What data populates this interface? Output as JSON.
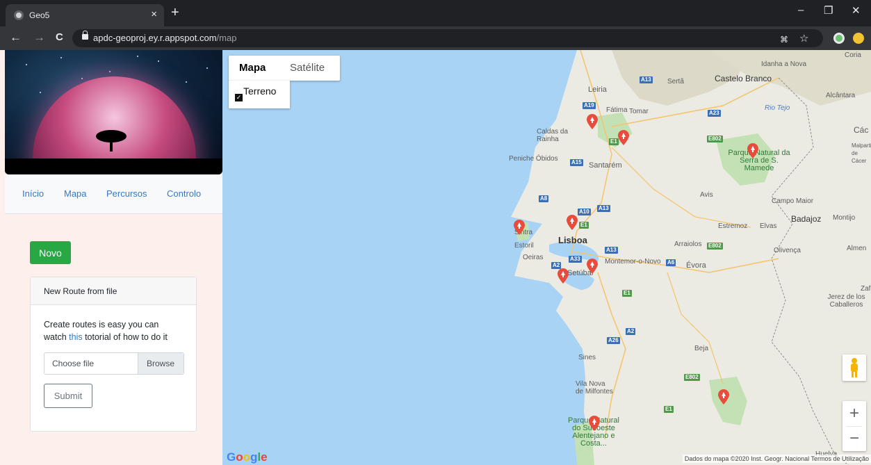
{
  "browser": {
    "tab_title": "Geo5",
    "tab_close": "×",
    "new_tab": "+",
    "minimize": "–",
    "restore": "❐",
    "close": "✕",
    "back": "←",
    "forward": "→",
    "reload": "C",
    "url_host": "apdc-geoproj.ey.r.appspot.com",
    "url_path": "/map",
    "translate_icon": "⌘",
    "bookmark_star": "☆"
  },
  "nav": {
    "items": [
      "Início",
      "Mapa",
      "Percursos",
      "Controlo"
    ]
  },
  "novo_button": "Novo",
  "card": {
    "header": "New Route from file",
    "text_before": "Create routes is easy you can watch ",
    "link": "this",
    "text_after": " totorial of how to do it",
    "file_placeholder": "Choose file",
    "browse": "Browse",
    "submit": "Submit"
  },
  "map": {
    "type_map": "Mapa",
    "type_satellite": "Satélite",
    "terrain": "Terreno",
    "terrain_checked": true,
    "zoom_in": "+",
    "zoom_out": "−",
    "google_logo": "Google",
    "attribution": "Dados do mapa ©2020 Inst. Geogr. Nacional   Termos de Utilização",
    "labels": {
      "coria": "Coria",
      "idanha": "Idanha a Nova",
      "castelo_branco": "Castelo Branco",
      "serta": "Sertã",
      "alcantara": "Alcântara",
      "leiria": "Leiria",
      "fatima": "Fátima",
      "tomar": "Tomar",
      "rio_tejo": "Rio Tejo",
      "caldas": "Caldas da Rainha",
      "caceres_abbr": "Các",
      "malpartida": "Malparti de Cácer",
      "peniche": "Peniche Óbidos",
      "santarem": "Santarém",
      "parque_serra": "Parque Natural da Serra de S. Mamede",
      "avis": "Avis",
      "campo_maior": "Campo Maior",
      "sintra": "Sintra",
      "estremoz": "Estremoz",
      "elvas": "Elvas",
      "badajoz": "Badajoz",
      "montijo": "Montijo",
      "lisboa": "Lisboa",
      "estoril": "Estoril",
      "oeiras": "Oeiras",
      "arraiolos": "Arraiolos",
      "olivenca": "Olivença",
      "almend": "Almen",
      "montemor": "Montemor-o-Novo",
      "evora": "Évora",
      "setubal": "Setúbal",
      "zafra": "Zaf",
      "jerez": "Jerez de los Caballeros",
      "sines": "Sines",
      "beja": "Beja",
      "vila_nova": "Vila Nova de Milfontes",
      "parque_sudoeste": "Parque Natural do Sudoeste Alentejano e Costa...",
      "huelva": "Huelva"
    },
    "road_shields": [
      "A13",
      "A19",
      "A23",
      "E802",
      "E1",
      "A15",
      "A8",
      "A10",
      "A13",
      "E1",
      "A13",
      "E802",
      "A33",
      "A6",
      "A2",
      "E1",
      "A2",
      "A26",
      "E802",
      "E1"
    ]
  },
  "colors": {
    "browser_dark": "#202124",
    "browser_tab": "#35363a",
    "page_bg": "#fdf0ec",
    "link_blue": "#3578c8",
    "novo_green": "#28a745",
    "map_water": "#a8d3f5",
    "map_land": "#ecebe3",
    "map_park": "#c3e1b4",
    "pin_red": "#e74c3c"
  }
}
